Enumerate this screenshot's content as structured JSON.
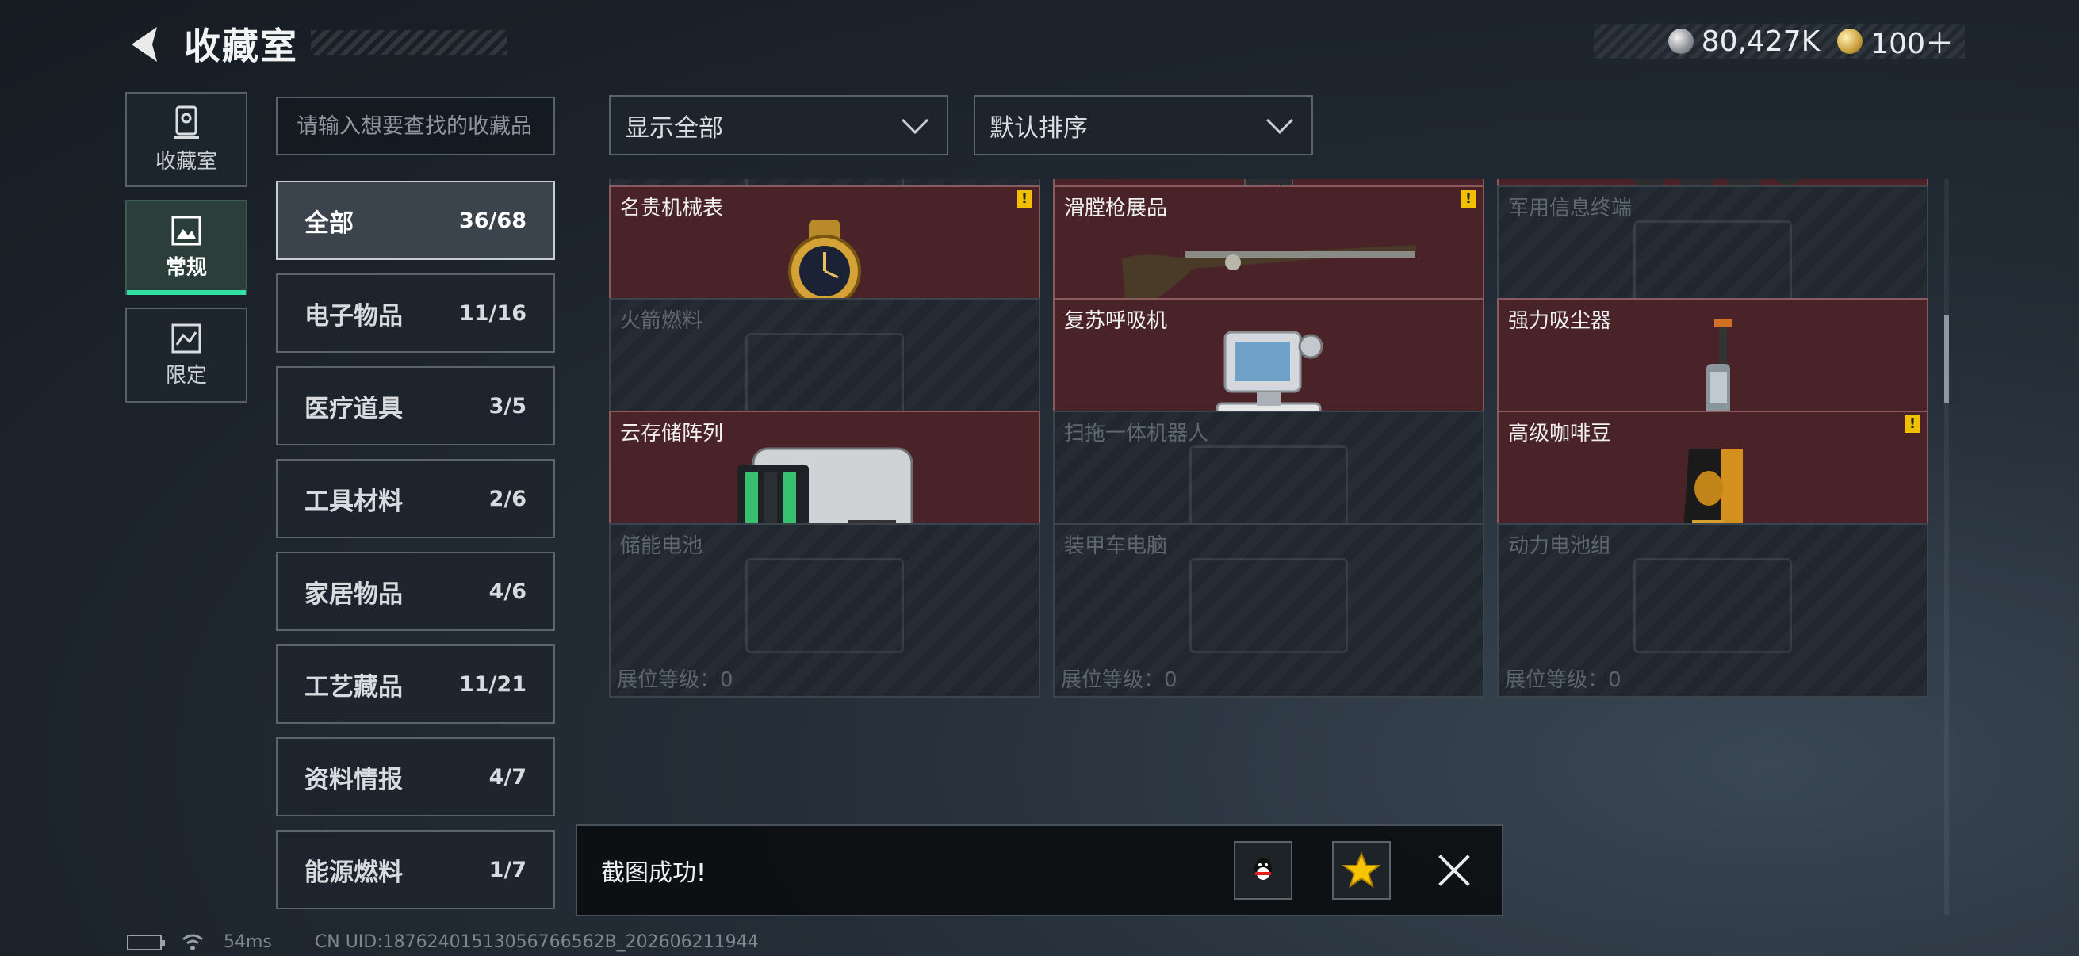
{
  "header": {
    "title": "收藏室",
    "currencies": [
      {
        "icon": "silver-coin-icon",
        "value": "80,427K"
      },
      {
        "icon": "gold-coin-icon",
        "value": "100＋"
      }
    ]
  },
  "left_tabs": [
    {
      "label": "收藏室",
      "icon": "trophy-icon",
      "active": false
    },
    {
      "label": "常规",
      "icon": "gallery-icon",
      "active": true
    },
    {
      "label": "限定",
      "icon": "limited-icon",
      "active": false
    }
  ],
  "search": {
    "placeholder": "请输入想要查找的收藏品",
    "value": ""
  },
  "categories": [
    {
      "name": "全部",
      "count": "36/68",
      "active": true
    },
    {
      "name": "电子物品",
      "count": "11/16"
    },
    {
      "name": "医疗道具",
      "count": "3/5"
    },
    {
      "name": "工具材料",
      "count": "2/6"
    },
    {
      "name": "家居物品",
      "count": "4/6"
    },
    {
      "name": "工艺藏品",
      "count": "11/21"
    },
    {
      "name": "资料情报",
      "count": "4/7"
    },
    {
      "name": "能源燃料",
      "count": "1/7"
    }
  ],
  "filters": {
    "show": "显示全部",
    "sort": "默认排序"
  },
  "level_label": "展位等级：0",
  "items": [
    {
      "name": "",
      "owned": false,
      "warn": false,
      "art": "ghost"
    },
    {
      "name": "",
      "owned": true,
      "warn": false,
      "art": "device"
    },
    {
      "name": "",
      "owned": true,
      "warn": false,
      "art": "vehicle"
    },
    {
      "name": "名贵机械表",
      "owned": true,
      "warn": true,
      "art": "watch"
    },
    {
      "name": "滑膛枪展品",
      "owned": true,
      "warn": true,
      "art": "musket"
    },
    {
      "name": "军用信息终端",
      "owned": false,
      "warn": false,
      "art": "ghost"
    },
    {
      "name": "火箭燃料",
      "owned": false,
      "warn": false,
      "art": "ghost"
    },
    {
      "name": "复苏呼吸机",
      "owned": true,
      "warn": false,
      "art": "respirator"
    },
    {
      "name": "强力吸尘器",
      "owned": true,
      "warn": false,
      "art": "vacuum"
    },
    {
      "name": "云存储阵列",
      "owned": true,
      "warn": false,
      "art": "storage"
    },
    {
      "name": "扫拖一体机器人",
      "owned": false,
      "warn": false,
      "art": "ghost"
    },
    {
      "name": "高级咖啡豆",
      "owned": true,
      "warn": true,
      "art": "coffee"
    },
    {
      "name": "储能电池",
      "owned": false,
      "warn": false,
      "art": "ghost"
    },
    {
      "name": "装甲车电脑",
      "owned": false,
      "warn": false,
      "art": "ghost"
    },
    {
      "name": "动力电池组",
      "owned": false,
      "warn": false,
      "art": "ghost"
    }
  ],
  "toast": {
    "text": "截图成功!",
    "share_buttons": [
      {
        "icon": "qq-icon"
      },
      {
        "icon": "qzone-star-icon"
      }
    ]
  },
  "footer": {
    "ping": "54ms",
    "uid": "CN UID:18762401513056766562B_202606211944"
  }
}
